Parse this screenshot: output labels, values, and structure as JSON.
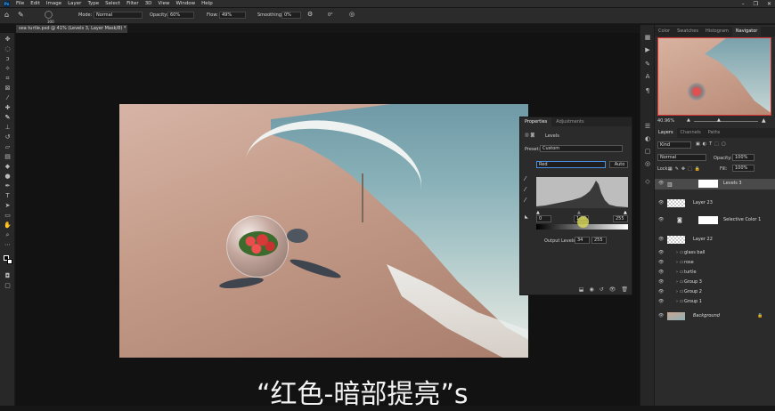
{
  "menu": {
    "items": [
      "File",
      "Edit",
      "Image",
      "Layer",
      "Type",
      "Select",
      "Filter",
      "3D",
      "View",
      "Window",
      "Help"
    ]
  },
  "options": {
    "size": "300",
    "mode_label": "Mode:",
    "mode": "Normal",
    "opacity_label": "Opacity:",
    "opacity": "60%",
    "flow_label": "Flow:",
    "flow": "49%",
    "smoothing_label": "Smoothing:",
    "smoothing": "0%",
    "angle": "0°"
  },
  "doc_tab": "sea turtle.psd @ 41% (Levels 3, Layer Mask/8) *",
  "properties": {
    "tab1": "Properties",
    "tab2": "Adjustments",
    "title": "Levels",
    "preset_label": "Preset:",
    "preset": "Custom",
    "channel": "Red",
    "auto": "Auto",
    "input_black": "0",
    "input_mid": "1.00",
    "input_white": "255",
    "output_label": "Output Levels:",
    "output_black": "34",
    "output_white": "255"
  },
  "right": {
    "tabs": [
      "Color",
      "Swatches",
      "Histogram",
      "Navigator"
    ],
    "zoom": "40.96%",
    "layer_tabs": [
      "Layers",
      "Channels",
      "Paths"
    ],
    "kind": "Kind",
    "blend": "Normal",
    "opacity_label": "Opacity:",
    "opacity": "100%",
    "lock_label": "Lock:",
    "fill_label": "Fill:",
    "fill": "100%"
  },
  "layers": [
    {
      "name": "Levels 3",
      "type": "adjust"
    },
    {
      "name": "Layer 23",
      "type": "pixel"
    },
    {
      "name": "Selective Color 1",
      "type": "adjust"
    },
    {
      "name": "Layer 22",
      "type": "pixel"
    },
    {
      "name": "glass ball",
      "type": "group"
    },
    {
      "name": "rose",
      "type": "group"
    },
    {
      "name": "turtle",
      "type": "group"
    },
    {
      "name": "Group 3",
      "type": "group"
    },
    {
      "name": "Group 2",
      "type": "group"
    },
    {
      "name": "Group 1",
      "type": "group"
    },
    {
      "name": "Background",
      "type": "bg"
    }
  ],
  "caption": "“红色-暗部提亮”s"
}
